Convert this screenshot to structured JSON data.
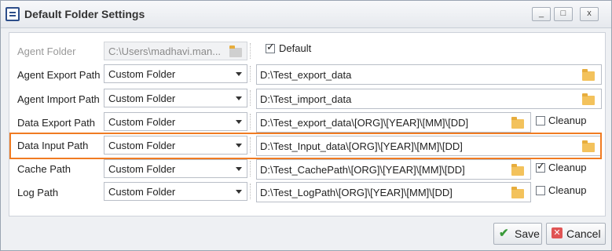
{
  "window": {
    "title": "Default Folder Settings",
    "buttons": {
      "minimize": "_",
      "maximize": "□",
      "close": "x"
    }
  },
  "agent_folder": {
    "label": "Agent Folder",
    "value": "C:\\Users\\madhavi.man...",
    "default_label": "Default",
    "default_checked": true
  },
  "rows": [
    {
      "label": "Agent Export Path",
      "mode": "Custom Folder",
      "path": "D:\\Test_export_data"
    },
    {
      "label": "Agent Import Path",
      "mode": "Custom Folder",
      "path": "D:\\Test_import_data"
    },
    {
      "label": "Data Export Path",
      "mode": "Custom Folder",
      "path": "D:\\Test_export_data\\[ORG]\\[YEAR]\\[MM]\\[DD]",
      "cleanup_label": "Cleanup",
      "cleanup_checked": false
    },
    {
      "label": "Data Input Path",
      "mode": "Custom Folder",
      "path": "D:\\Test_Input_data\\[ORG]\\[YEAR]\\[MM]\\[DD]"
    },
    {
      "label": "Cache Path",
      "mode": "Custom Folder",
      "path": "D:\\Test_CachePath\\[ORG]\\[YEAR]\\[MM]\\[DD]",
      "cleanup_label": "Cleanup",
      "cleanup_checked": true
    },
    {
      "label": "Log Path",
      "mode": "Custom Folder",
      "path": "D:\\Test_LogPath\\[ORG]\\[YEAR]\\[MM]\\[DD]",
      "cleanup_label": "Cleanup",
      "cleanup_checked": false
    }
  ],
  "footer": {
    "save_label": "Save",
    "cancel_label": "Cancel"
  },
  "colors": {
    "highlight": "#f07b22",
    "folder": "#f3c25c",
    "save_check": "#3a9a3a",
    "cancel_icon": "#e05454"
  }
}
